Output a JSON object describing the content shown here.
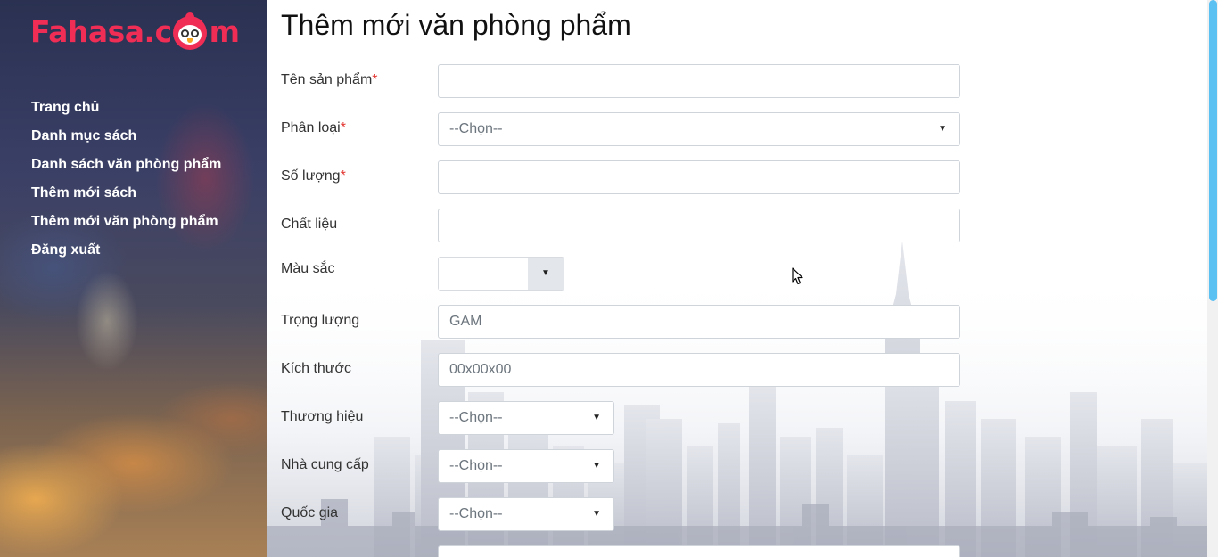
{
  "brand": {
    "name_part1": "Fahasa.c",
    "name_part2": "m",
    "color": "#ef2d55"
  },
  "sidebar": {
    "items": [
      {
        "label": "Trang chủ"
      },
      {
        "label": "Danh mục sách"
      },
      {
        "label": "Danh sách văn phòng phẩm"
      },
      {
        "label": "Thêm mới sách"
      },
      {
        "label": "Thêm mới văn phòng phẩm"
      },
      {
        "label": "Đăng xuất"
      }
    ]
  },
  "page": {
    "title": "Thêm mới văn phòng phẩm"
  },
  "form": {
    "required_mark": "*",
    "product_name": {
      "label": "Tên sản phẩm",
      "value": "",
      "placeholder": ""
    },
    "category": {
      "label": "Phân loại",
      "selected": "--Chọn--"
    },
    "quantity": {
      "label": "Số lượng",
      "value": "",
      "placeholder": ""
    },
    "material": {
      "label": "Chất liệu",
      "value": "",
      "placeholder": ""
    },
    "color": {
      "label": "Màu sắc",
      "value": "#ffffff"
    },
    "weight": {
      "label": "Trọng lượng",
      "placeholder": "GAM"
    },
    "size": {
      "label": "Kích thước",
      "placeholder": "00x00x00"
    },
    "brand": {
      "label": "Thương hiệu",
      "selected": "--Chọn--"
    },
    "supplier": {
      "label": "Nhà cung cấp",
      "selected": "--Chọn--"
    },
    "country": {
      "label": "Quốc gia",
      "selected": "--Chọn--"
    }
  },
  "icons": {
    "caret": "caret-down-icon",
    "cursor": "mouse-pointer-icon"
  },
  "colors": {
    "scroll_thumb": "#5bc0f2",
    "required": "#e3342f"
  }
}
